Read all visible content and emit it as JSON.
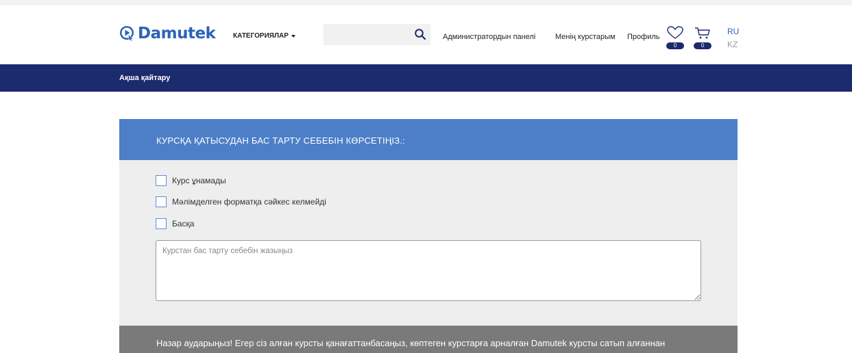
{
  "header": {
    "logo_text": "Damutek",
    "categories_label": "КАТЕГОРИЯЛАР",
    "search": {
      "placeholder": "",
      "value": ""
    },
    "nav": {
      "admin_panel": "Администратордын панелі",
      "my_courses": "Менің курстарым",
      "profile": "Профиль"
    },
    "wishlist_count": "0",
    "cart_count": "0",
    "languages": [
      "RU",
      "KZ"
    ]
  },
  "subheader": {
    "title": "Ақша қайтару"
  },
  "refund_form": {
    "heading": "КУРСҚА ҚАТЫСУДАН БАС ТАРТУ СЕБЕБІН КӨРСЕТІҢІЗ.:",
    "options": [
      {
        "label": "Курс ұнамады",
        "checked": false
      },
      {
        "label": "Мәлімделген форматқа сәйкес келмейді",
        "checked": false
      },
      {
        "label": "Басқа",
        "checked": false
      }
    ],
    "reason_placeholder": "Курстан бас тарту себебін жазыңыз",
    "notice": "Назар аударыңыз! Егер сіз алған курсты қанағаттанбасаңыз, көптеген курстарға арналған Damutek курсты сатып алғаннан"
  },
  "colors": {
    "brand_blue": "#2b63b8",
    "navy_bar": "#1c2a6e",
    "card_header": "#4c7fc7",
    "notice_bg": "#7a7a7a"
  }
}
